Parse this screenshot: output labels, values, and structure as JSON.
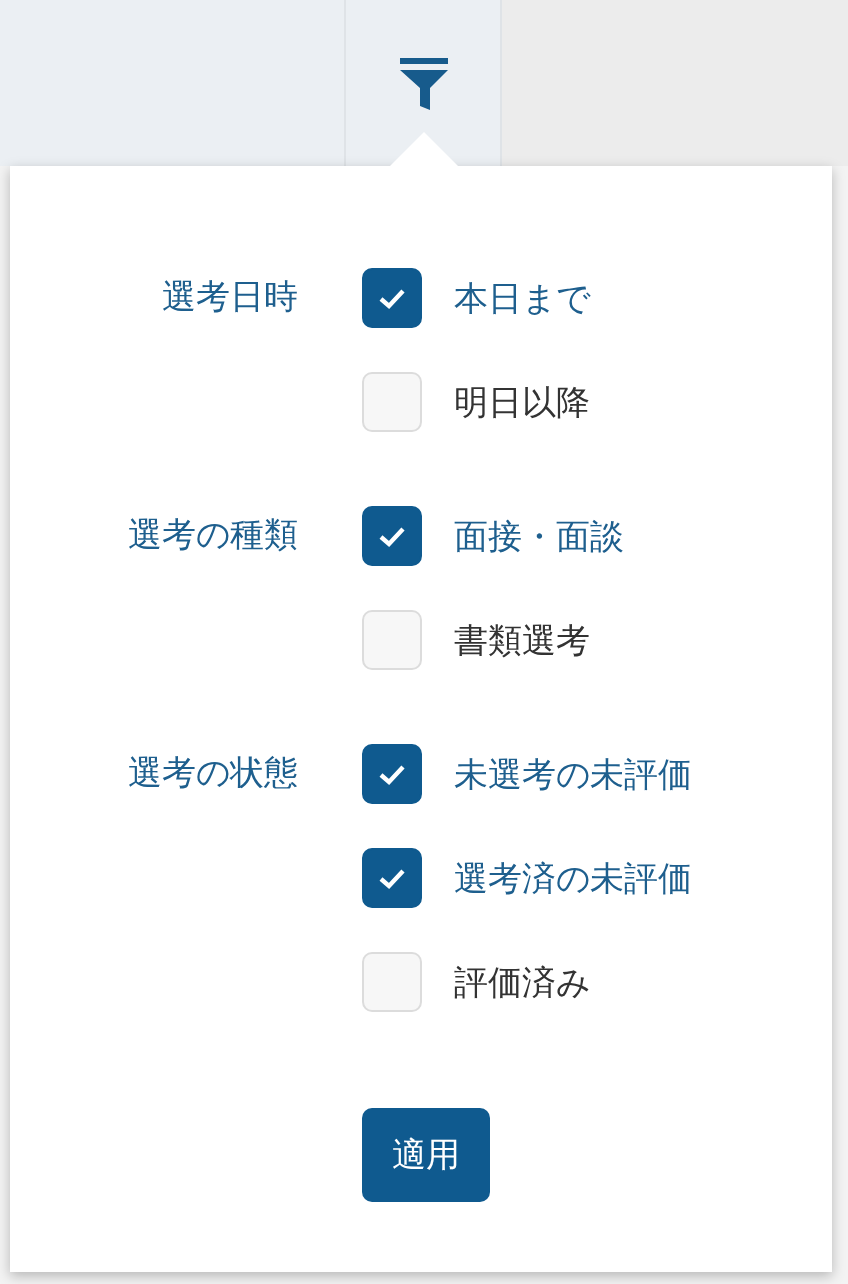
{
  "filter_popover": {
    "groups": [
      {
        "label": "選考日時",
        "options": [
          {
            "label": "本日まで",
            "checked": true
          },
          {
            "label": "明日以降",
            "checked": false
          }
        ]
      },
      {
        "label": "選考の種類",
        "options": [
          {
            "label": "面接・面談",
            "checked": true
          },
          {
            "label": "書類選考",
            "checked": false
          }
        ]
      },
      {
        "label": "選考の状態",
        "options": [
          {
            "label": "未選考の未評価",
            "checked": true
          },
          {
            "label": "選考済の未評価",
            "checked": true
          },
          {
            "label": "評価済み",
            "checked": false
          }
        ]
      }
    ],
    "apply_button": "適用"
  }
}
